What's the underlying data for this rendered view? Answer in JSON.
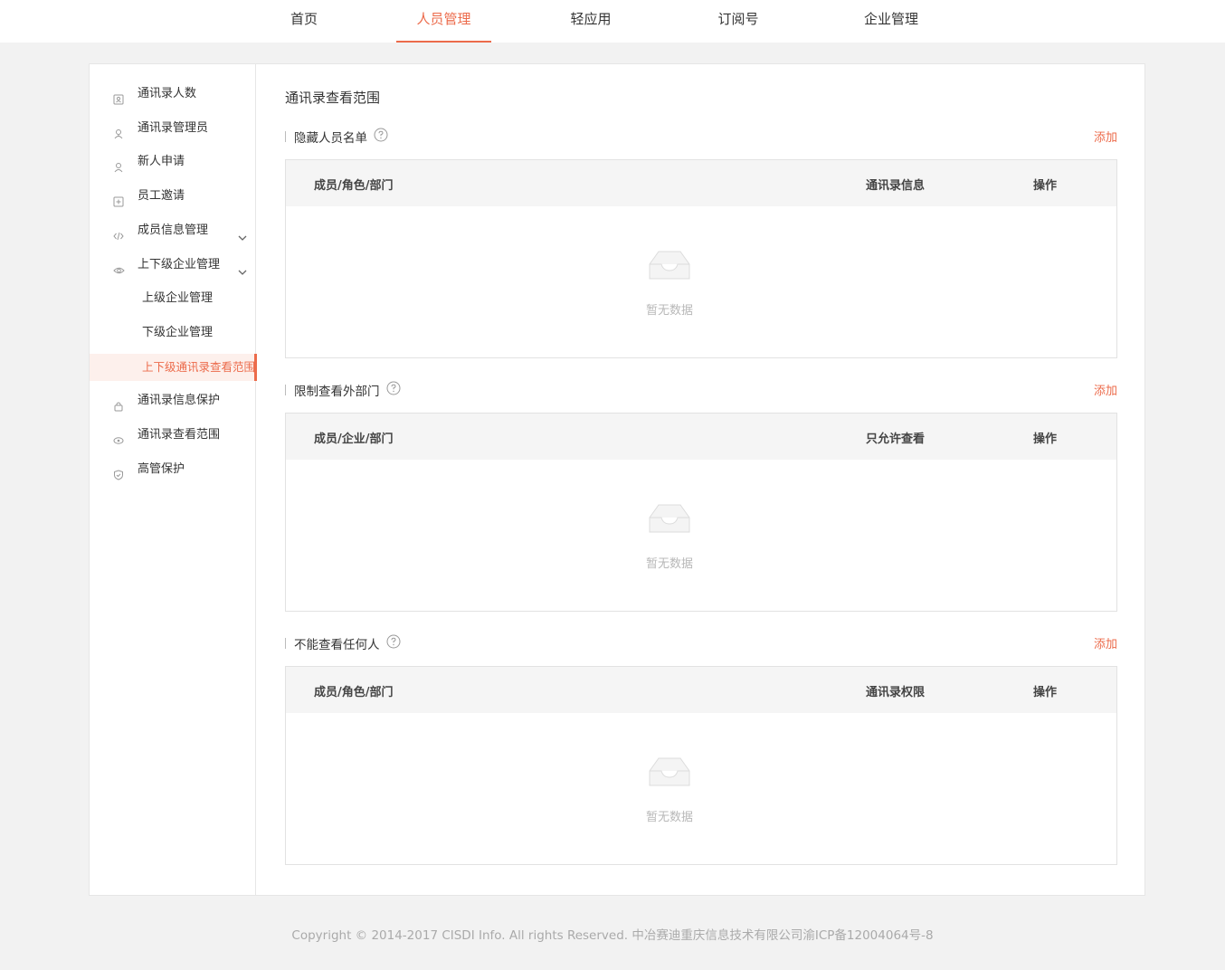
{
  "topnav": {
    "tabs": [
      {
        "label": "首页",
        "active": false
      },
      {
        "label": "人员管理",
        "active": true
      },
      {
        "label": "轻应用",
        "active": false
      },
      {
        "label": "订阅号",
        "active": false
      },
      {
        "label": "企业管理",
        "active": false
      }
    ]
  },
  "sidebar": {
    "items": [
      {
        "label": "通讯录人数",
        "icon": "contact-card-icon"
      },
      {
        "label": "通讯录管理员",
        "icon": "admin-user-icon"
      },
      {
        "label": "新人申请",
        "icon": "user-icon"
      },
      {
        "label": "员工邀请",
        "icon": "plus-square-icon"
      },
      {
        "label": "成员信息管理",
        "icon": "code-icon",
        "expandable": true
      },
      {
        "label": "上下级企业管理",
        "icon": "eye-icon",
        "expandable": true
      },
      {
        "label": "上级企业管理",
        "sub": true
      },
      {
        "label": "下级企业管理",
        "sub": true
      },
      {
        "label": "上下级通讯录查看范围",
        "sub": true,
        "active": true
      },
      {
        "label": "通讯录信息保护",
        "icon": "lock-icon"
      },
      {
        "label": "通讯录查看范围",
        "icon": "eye-small-icon"
      },
      {
        "label": "高管保护",
        "icon": "shield-icon"
      }
    ]
  },
  "main": {
    "title": "通讯录查看范围",
    "sections": [
      {
        "title": "隐藏人员名单",
        "add_label": "添加",
        "columns": [
          "成员/角色/部门",
          "通讯录信息",
          "操作"
        ],
        "empty_text": "暂无数据"
      },
      {
        "title": "限制查看外部门",
        "add_label": "添加",
        "columns": [
          "成员/企业/部门",
          "只允许查看",
          "操作"
        ],
        "empty_text": "暂无数据"
      },
      {
        "title": "不能查看任何人",
        "add_label": "添加",
        "columns": [
          "成员/角色/部门",
          "通讯录权限",
          "操作"
        ],
        "empty_text": "暂无数据"
      }
    ]
  },
  "footer": {
    "text": "Copyright © 2014-2017 CISDI Info. All rights Reserved. 中冶赛迪重庆信息技术有限公司渝ICP备12004064号-8"
  },
  "colors": {
    "accent": "#ec6b4b",
    "background": "#f2f2f2",
    "table_header": "#f5f5f5"
  }
}
